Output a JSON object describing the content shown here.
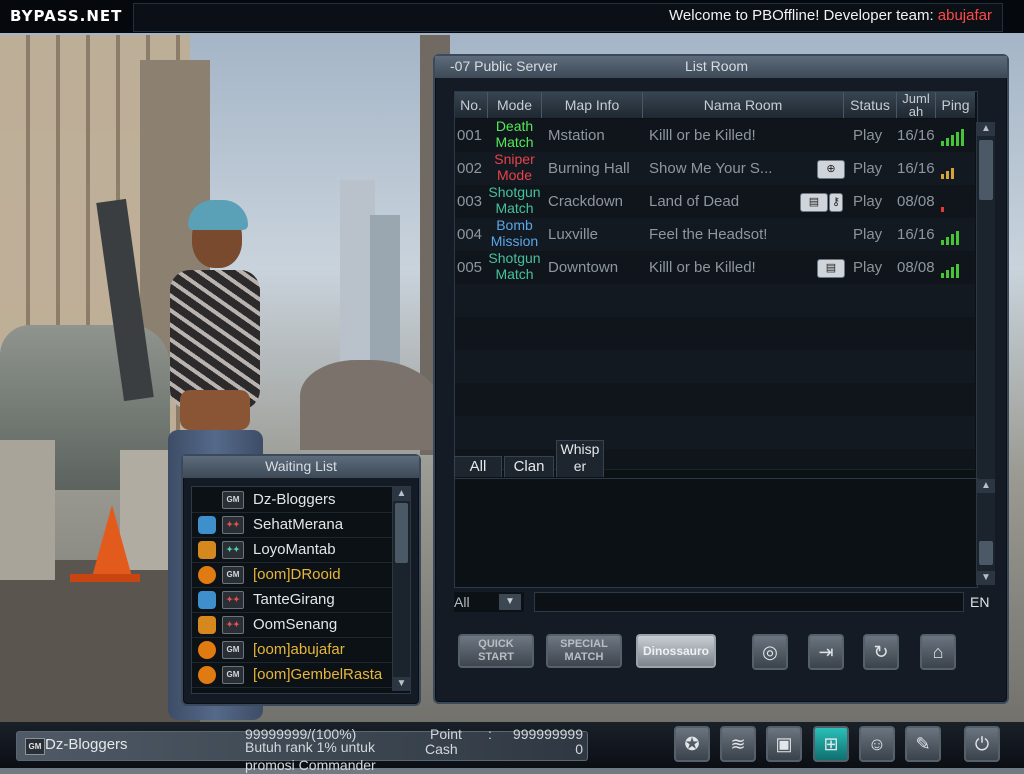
{
  "topbar": {
    "logo": "BYPASS.NET",
    "welcome_text": "Welcome to PBOffline! Developer team: ",
    "developer": "abujafar"
  },
  "list_room": {
    "server": "-07 Public Server",
    "title": "List Room",
    "headers": {
      "no": "No.",
      "mode": "Mode",
      "map": "Map Info",
      "room": "Nama Room",
      "status": "Status",
      "jumlah": "Juml ah",
      "ping": "Ping"
    },
    "rooms": [
      {
        "no": "001",
        "mode": "Death Match",
        "mode_color": "#55e85a",
        "map": "Mstation",
        "room": "Killl or be Killed!",
        "status": "Play",
        "count": "16/16",
        "ping": 5
      },
      {
        "no": "002",
        "mode": "Sniper Mode",
        "mode_color": "#e8434a",
        "map": "Burning Hall",
        "room": "Show Me Your S...",
        "status": "Play",
        "count": "16/16",
        "ping": 3
      },
      {
        "no": "003",
        "mode": "Shotgun Match",
        "mode_color": "#45c29a",
        "map": "Crackdown",
        "room": "Land of Dead",
        "status": "Play",
        "count": "08/08",
        "ping": 1
      },
      {
        "no": "004",
        "mode": "Bomb Mission",
        "mode_color": "#5aa6e8",
        "map": "Luxville",
        "room": "Feel the Headsot!",
        "status": "Play",
        "count": "16/16",
        "ping": 4
      },
      {
        "no": "005",
        "mode": "Shotgun Match",
        "mode_color": "#45c29a",
        "map": "Downtown",
        "room": "Killl or be Killed!",
        "status": "Play",
        "count": "08/08",
        "ping": 4
      }
    ]
  },
  "chat": {
    "tabs": {
      "all": "All",
      "clan": "Clan",
      "whisper": "Whisp er"
    },
    "channel": "All",
    "lang": "EN"
  },
  "buttons": {
    "quick_start": "QUICK START",
    "special_match": "SPECIAL MATCH",
    "dinossauro": "Dinossauro"
  },
  "waiting_list": {
    "title": "Waiting List",
    "players": [
      {
        "name": "Dz-Bloggers",
        "rank": "none",
        "badge": "GM",
        "gold": false
      },
      {
        "name": "SehatMerana",
        "rank": "blue",
        "badge": "red",
        "gold": false
      },
      {
        "name": "LoyoMantab",
        "rank": "gold",
        "badge": "green",
        "gold": false
      },
      {
        "name": "[oom]DRooid",
        "rank": "orange",
        "badge": "GM",
        "gold": true
      },
      {
        "name": "TanteGirang",
        "rank": "blue",
        "badge": "red",
        "gold": false
      },
      {
        "name": "OomSenang",
        "rank": "gold",
        "badge": "red",
        "gold": false
      },
      {
        "name": "[oom]abujafar",
        "rank": "orange",
        "badge": "GM",
        "gold": true
      },
      {
        "name": "[oom]GembelRasta",
        "rank": "orange",
        "badge": "GM",
        "gold": true
      }
    ]
  },
  "bottombar": {
    "badge": "GM",
    "player_name": "Dz-Bloggers",
    "rank_exp": "99999999/(100%)",
    "promo": "Butuh rank 1% untuk promosi Commander",
    "point_label": "Point",
    "point_colon": ":",
    "point_value": "999999999",
    "cash_label": "Cash",
    "cash_value": "0"
  },
  "colors": {
    "accent": "#3a4a5c",
    "developer": "#ff4a4a",
    "gold_name": "#e6b63a",
    "ping_good": "#46c636",
    "ping_mid": "#d6a23a",
    "ping_low": "#e23a3a"
  },
  "icons": {
    "room_003": [
      "camera-icon",
      "key-icon"
    ],
    "room_002": [
      "crosshair-icon"
    ],
    "room_005": [
      "camera-icon"
    ],
    "nav": [
      "emblem-icon",
      "rank-icon",
      "inventory-icon",
      "shop-icon",
      "friends-icon",
      "settings-icon",
      "power-icon"
    ],
    "tools": [
      "globe-icon",
      "exit-icon",
      "refresh-icon",
      "home-icon"
    ]
  }
}
